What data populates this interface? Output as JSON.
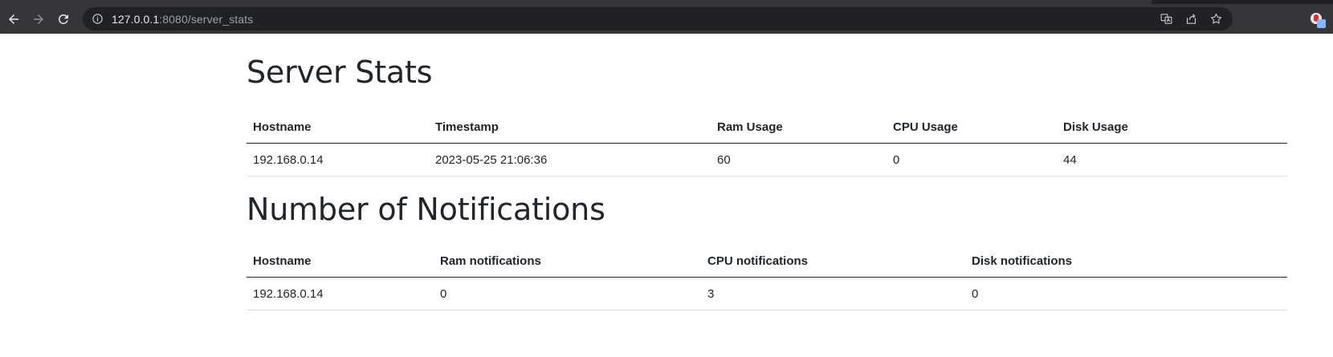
{
  "browser": {
    "url_host": "127.0.0.1",
    "url_rest": ":8080/server_stats"
  },
  "stats": {
    "title": "Server Stats",
    "headers": [
      "Hostname",
      "Timestamp",
      "Ram Usage",
      "CPU Usage",
      "Disk Usage"
    ],
    "rows": [
      [
        "192.168.0.14",
        "2023-05-25 21:06:36",
        "60",
        "0",
        "44"
      ]
    ]
  },
  "notifications": {
    "title": "Number of Notifications",
    "headers": [
      "Hostname",
      "Ram notifications",
      "CPU notifications",
      "Disk notifications"
    ],
    "rows": [
      [
        "192.168.0.14",
        "0",
        "3",
        "0"
      ]
    ]
  }
}
